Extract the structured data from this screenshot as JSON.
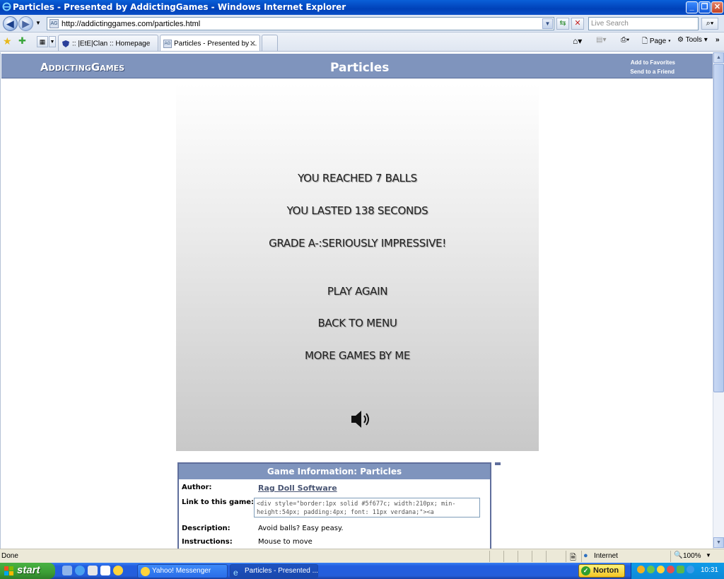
{
  "window": {
    "title": "Particles - Presented by AddictingGames - Windows Internet Explorer"
  },
  "address_bar": {
    "url": "http://addictinggames.com/particles.html",
    "search_placeholder": "Live Search"
  },
  "tabs": [
    {
      "label": ":: |EtE|Clan :: Homepage",
      "active": false
    },
    {
      "label": "Particles - Presented by ...",
      "active": true
    }
  ],
  "toolbar": {
    "page_label": "Page",
    "tools_label": "Tools"
  },
  "site_header": {
    "logo": "AddictingGames",
    "page_title": "Particles",
    "add_favorites": "Add to Favorites",
    "send_friend": "Send to a Friend"
  },
  "game_screen": {
    "line1": "YOU REACHED 7 BALLS",
    "line2": "YOU LASTED 138 SECONDS",
    "line3": "GRADE A-:SERIOUSLY IMPRESSIVE!",
    "play_again": "PLAY AGAIN",
    "back_to_menu": "BACK TO MENU",
    "more_games": "MORE GAMES BY ME"
  },
  "game_info": {
    "heading": "Game Information: Particles",
    "author_label": "Author:",
    "author_value": "Rag Doll Software",
    "link_label": "Link to this game:",
    "link_code": "<div style=\"border:1px solid #5f677c; width:210px; min-height:54px; padding:4px; font: 11px verdana;\"><a",
    "description_label": "Description:",
    "description_value": "Avoid balls? Easy peasy.",
    "instructions_label": "Instructions:",
    "instructions_value": "Mouse to move"
  },
  "status_bar": {
    "status": "Done",
    "zone": "Internet",
    "zoom": "100%"
  },
  "taskbar": {
    "start": "start",
    "items": [
      {
        "label": "Yahoo! Messenger"
      },
      {
        "label": "Particles - Presented ..."
      }
    ],
    "norton": "Norton",
    "clock": "10:31"
  },
  "colors": {
    "site_header": "#7f94bd",
    "info_border": "#5f6e9c",
    "taskbar": "#245edb",
    "start_button": "#3c9e35"
  }
}
